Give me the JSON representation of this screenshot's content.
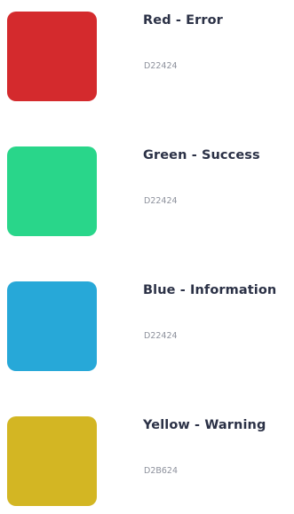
{
  "swatches": [
    {
      "title": "Red - Error",
      "code": "D22424",
      "color": "#d42a2d"
    },
    {
      "title": "Green - Success",
      "code": "D22424",
      "color": "#29d68a"
    },
    {
      "title": "Blue - Information",
      "code": "D22424",
      "color": "#27a8d8"
    },
    {
      "title": "Yellow - Warning",
      "code": "D2B624",
      "color": "#d3b623"
    }
  ]
}
